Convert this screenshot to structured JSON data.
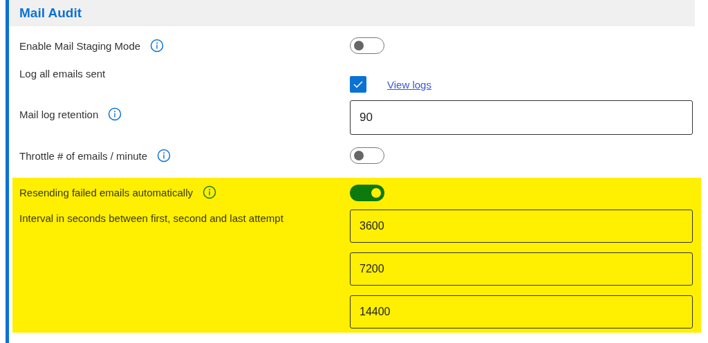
{
  "section": {
    "title": "Mail Audit"
  },
  "settings": [
    {
      "kind": "toggle",
      "label": "Enable Mail Staging Mode",
      "info": true,
      "on": false,
      "highlighted": false
    },
    {
      "kind": "checkbox",
      "label": "Log all emails sent",
      "info": false,
      "checked": true,
      "link": "View logs",
      "highlighted": false
    },
    {
      "kind": "input",
      "label": "Mail log retention",
      "info": true,
      "values": [
        "90"
      ],
      "highlighted": false
    },
    {
      "kind": "toggle",
      "label": "Throttle # of emails / minute",
      "info": true,
      "on": false,
      "highlighted": false
    },
    {
      "kind": "toggle",
      "label": "Resending failed emails automatically",
      "info": true,
      "on": true,
      "highlighted": true
    },
    {
      "kind": "input",
      "label": "Interval in seconds between first, second and last attempt",
      "info": false,
      "values": [
        "3600",
        "7200",
        "14400"
      ],
      "highlighted": true
    }
  ]
}
